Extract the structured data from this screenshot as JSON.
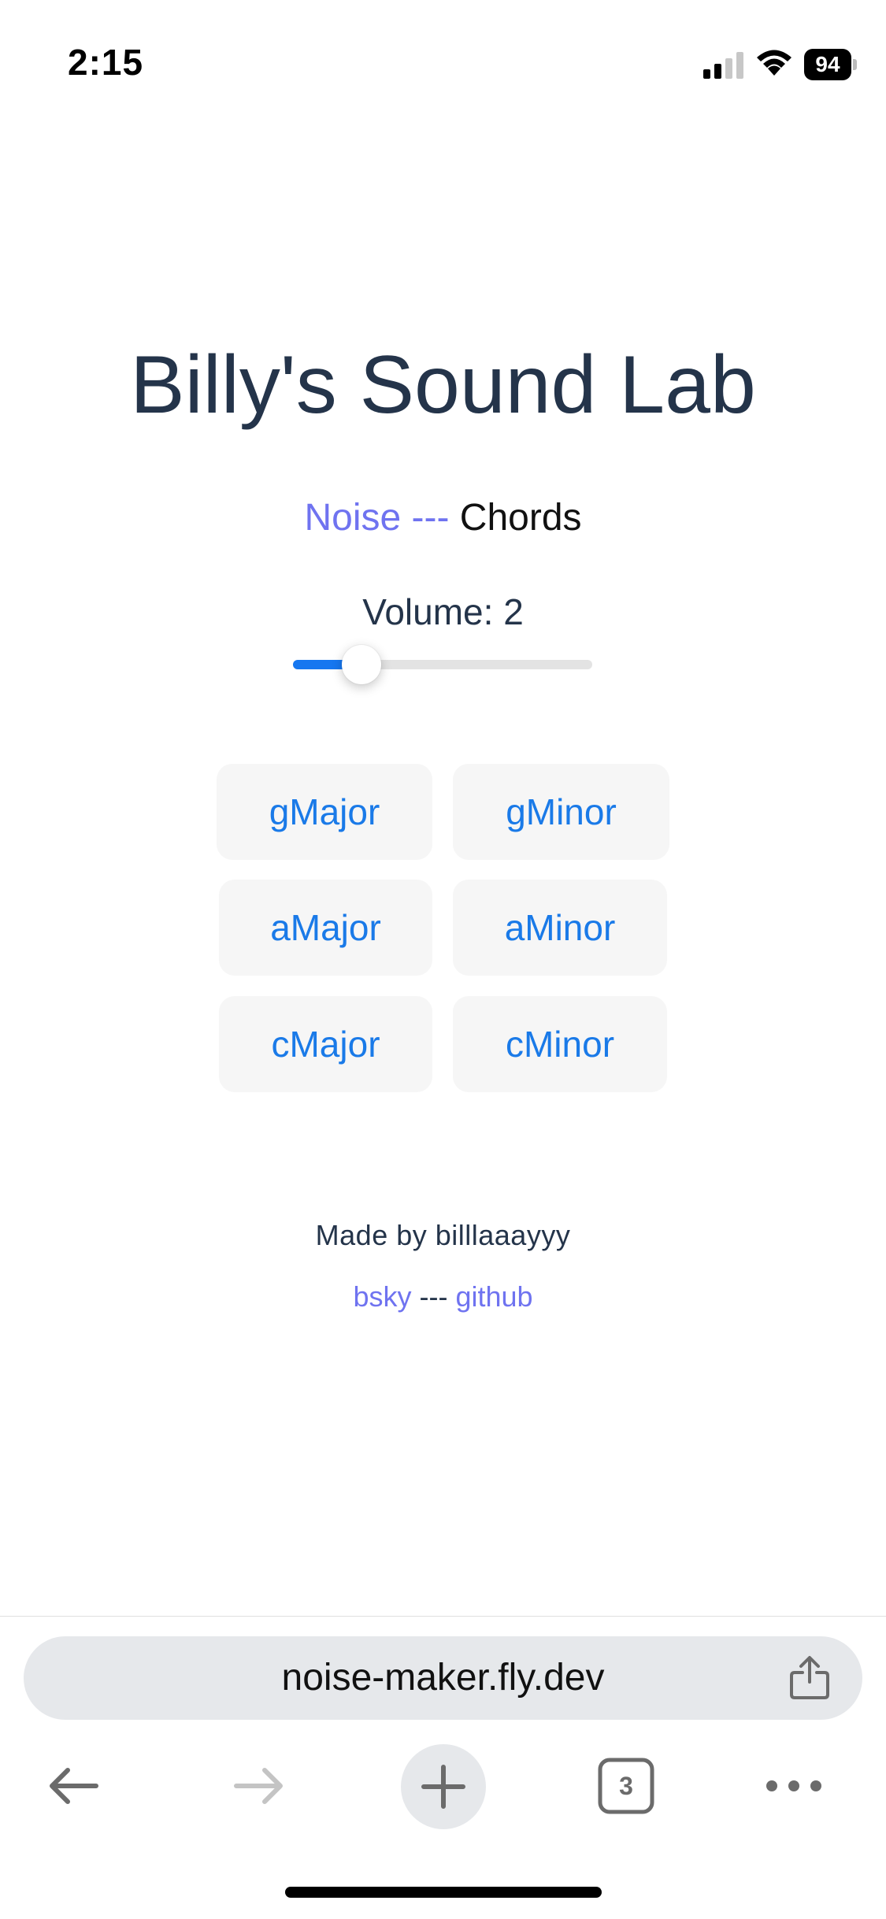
{
  "status_bar": {
    "time": "2:15",
    "battery": "94"
  },
  "page": {
    "title": "Billy's Sound Lab",
    "mode": {
      "noise": "Noise",
      "separator": " --- ",
      "chords": "Chords"
    },
    "volume": {
      "label": "Volume: 2",
      "value_fraction": 0.23
    },
    "chords": [
      {
        "label": "gMajor"
      },
      {
        "label": "gMinor"
      },
      {
        "label": "aMajor"
      },
      {
        "label": "aMinor"
      },
      {
        "label": "cMajor"
      },
      {
        "label": "cMinor"
      }
    ],
    "footer": {
      "made_by": "Made by billlaaayyy",
      "link_bsky": "bsky",
      "link_sep": " --- ",
      "link_github": "github"
    }
  },
  "browser": {
    "url": "noise-maker.fly.dev",
    "tab_count": "3"
  },
  "colors": {
    "link": "#6f73f0",
    "accent": "#1677f0",
    "chord_text": "#1a7ae8",
    "title": "#24344a"
  }
}
